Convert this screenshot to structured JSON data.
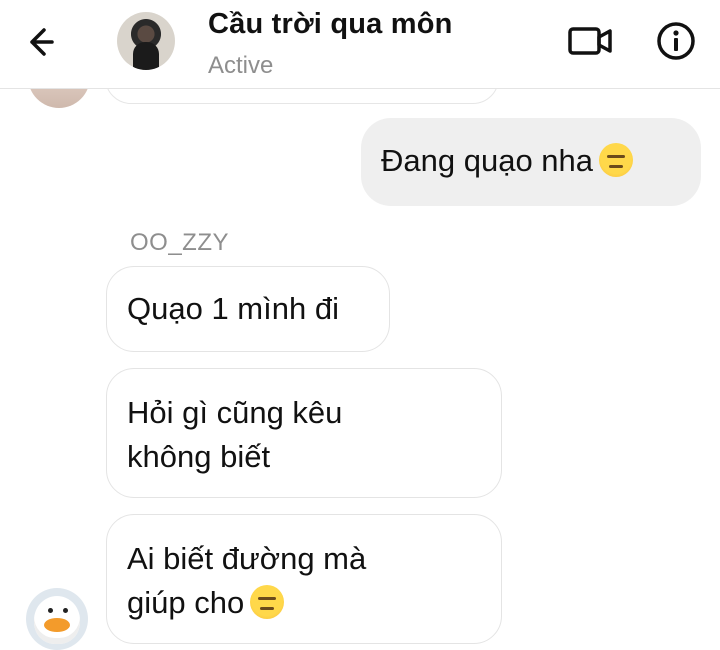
{
  "header": {
    "title": "Cầu trời qua môn",
    "status": "Active",
    "back_icon": "arrow-left-icon",
    "video_icon": "video-camera-icon",
    "info_icon": "info-circle-icon"
  },
  "messages": {
    "outgoing": [
      {
        "text": "Đang quạo nha",
        "emoji": "expressionless-face-emoji"
      }
    ],
    "sender_name": "OO_ZZY",
    "incoming": [
      {
        "text": "Quạo 1 mình đi"
      },
      {
        "line1": "Hỏi gì cũng kêu",
        "line2": "không biết"
      },
      {
        "line1": "Ai biết đường mà",
        "line2": "giúp cho",
        "emoji": "expressionless-face-emoji"
      }
    ]
  },
  "colors": {
    "outgoing_bubble": "#efefef",
    "incoming_border": "#e4e4e4",
    "secondary_text": "#8e8e8e",
    "emoji_yellow": "#ffd84a"
  }
}
